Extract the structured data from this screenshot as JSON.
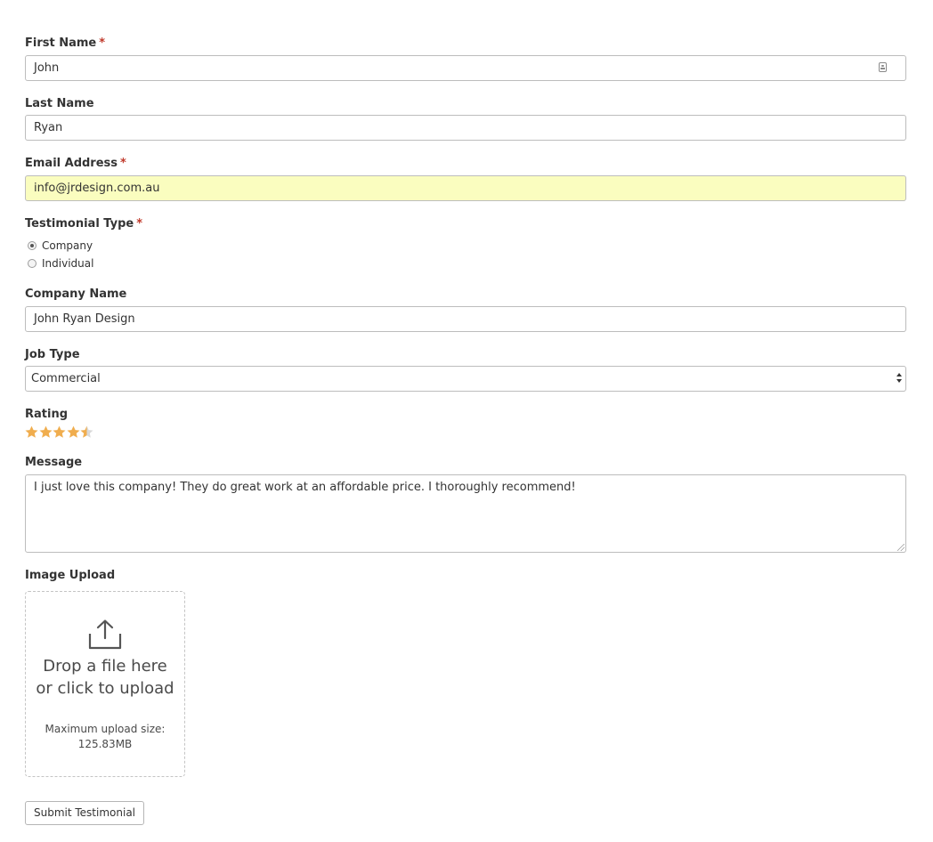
{
  "form": {
    "first_name": {
      "label": "First Name",
      "required_mark": "*",
      "value": "John"
    },
    "last_name": {
      "label": "Last Name",
      "value": "Ryan"
    },
    "email": {
      "label": "Email Address",
      "required_mark": "*",
      "value": "info@jrdesign.com.au",
      "highlight_color": "#fafdbf"
    },
    "testimonial_type": {
      "label": "Testimonial Type",
      "required_mark": "*",
      "options": [
        {
          "label": "Company",
          "checked": true
        },
        {
          "label": "Individual",
          "checked": false
        }
      ]
    },
    "company_name": {
      "label": "Company Name",
      "value": "John Ryan Design"
    },
    "job_type": {
      "label": "Job Type",
      "selected": "Commercial"
    },
    "rating": {
      "label": "Rating",
      "value": 4.5,
      "max": 5,
      "star_color": "#f0ad4e"
    },
    "message": {
      "label": "Message",
      "value": "I just love this company! They do great work at an affordable price. I thoroughly recommend!"
    },
    "image_upload": {
      "label": "Image Upload",
      "drop_text": "Drop a file here or click to upload",
      "max_size_label": "Maximum upload size:",
      "max_size_value": "125.83MB",
      "icon": "upload-icon"
    },
    "submit_label": "Submit Testimonial"
  },
  "colors": {
    "required": "#c0392b",
    "border": "#bdbdbd",
    "text": "#333333"
  }
}
